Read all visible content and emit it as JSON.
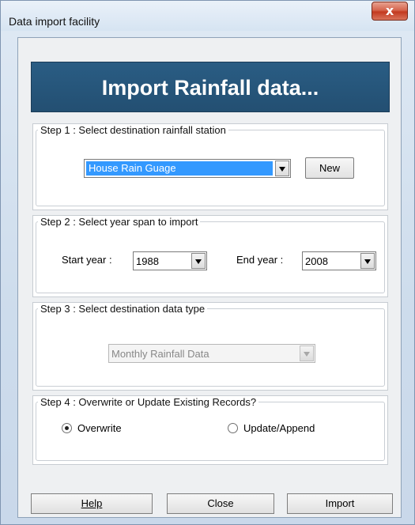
{
  "window": {
    "title": "Data import facility",
    "close_glyph": "x"
  },
  "header": {
    "title": "Import Rainfall data..."
  },
  "step1": {
    "legend": "Step 1 : Select destination rainfall station",
    "station_value": "House Rain Guage",
    "new_label": "New"
  },
  "step2": {
    "legend": "Step 2 : Select year span to import",
    "start_label": "Start year :",
    "start_value": "1988",
    "end_label": "End year :",
    "end_value": "2008"
  },
  "step3": {
    "legend": "Step 3 : Select destination data type",
    "type_value": "Monthly Rainfall Data"
  },
  "step4": {
    "legend": "Step 4 : Overwrite or Update Existing Records?",
    "overwrite_label": "Overwrite",
    "update_label": "Update/Append",
    "selected": "Overwrite"
  },
  "buttons": {
    "help": "Help",
    "close": "Close",
    "import": "Import"
  },
  "colors": {
    "header_bg": "#2a5d84",
    "selection": "#3399ff",
    "close_button": "#c9462b"
  }
}
